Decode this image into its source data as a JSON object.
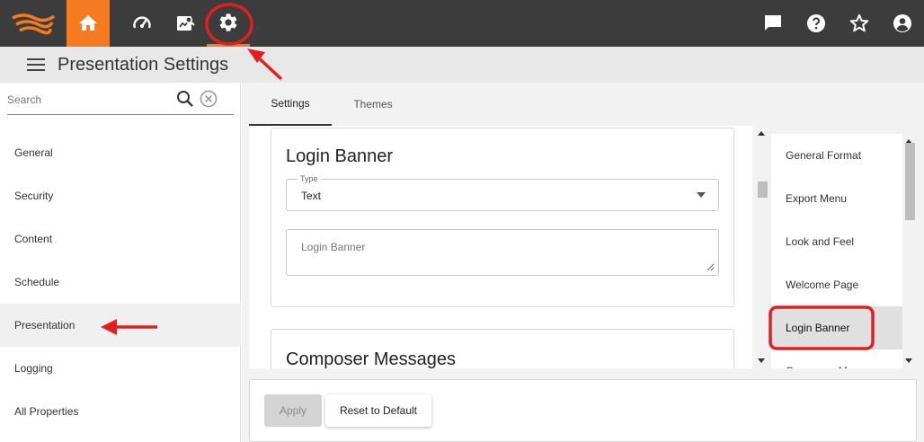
{
  "topbar": {
    "logo_icon": "app-logo",
    "home_icon": "home-icon",
    "dashboard_icon": "speedometer-icon",
    "monitor_icon": "chart-search-icon",
    "settings_icon": "gear-icon",
    "message_icon": "chat-icon",
    "help_icon": "help-icon",
    "favorite_icon": "star-icon",
    "account_icon": "account-icon",
    "accent_color": "#f47b20",
    "bar_color": "#3c3c3c"
  },
  "header": {
    "title": "Presentation Settings"
  },
  "sidebar": {
    "search_placeholder": "Search",
    "items": [
      {
        "label": "General"
      },
      {
        "label": "Security"
      },
      {
        "label": "Content"
      },
      {
        "label": "Schedule"
      },
      {
        "label": "Presentation"
      },
      {
        "label": "Logging"
      },
      {
        "label": "All Properties"
      }
    ]
  },
  "tabs": [
    {
      "label": "Settings"
    },
    {
      "label": "Themes"
    }
  ],
  "login_banner": {
    "title": "Login Banner",
    "type_label": "Type",
    "type_value": "Text",
    "textarea_placeholder": "Login Banner"
  },
  "composer": {
    "title": "Composer Messages"
  },
  "rightnav": {
    "items": [
      {
        "label": "General Format"
      },
      {
        "label": "Export Menu"
      },
      {
        "label": "Look and Feel"
      },
      {
        "label": "Welcome Page"
      },
      {
        "label": "Login Banner"
      },
      {
        "label": "Composer Messages"
      }
    ]
  },
  "footer": {
    "apply_label": "Apply",
    "reset_label": "Reset to Default"
  },
  "annotation_color": "#e02020"
}
